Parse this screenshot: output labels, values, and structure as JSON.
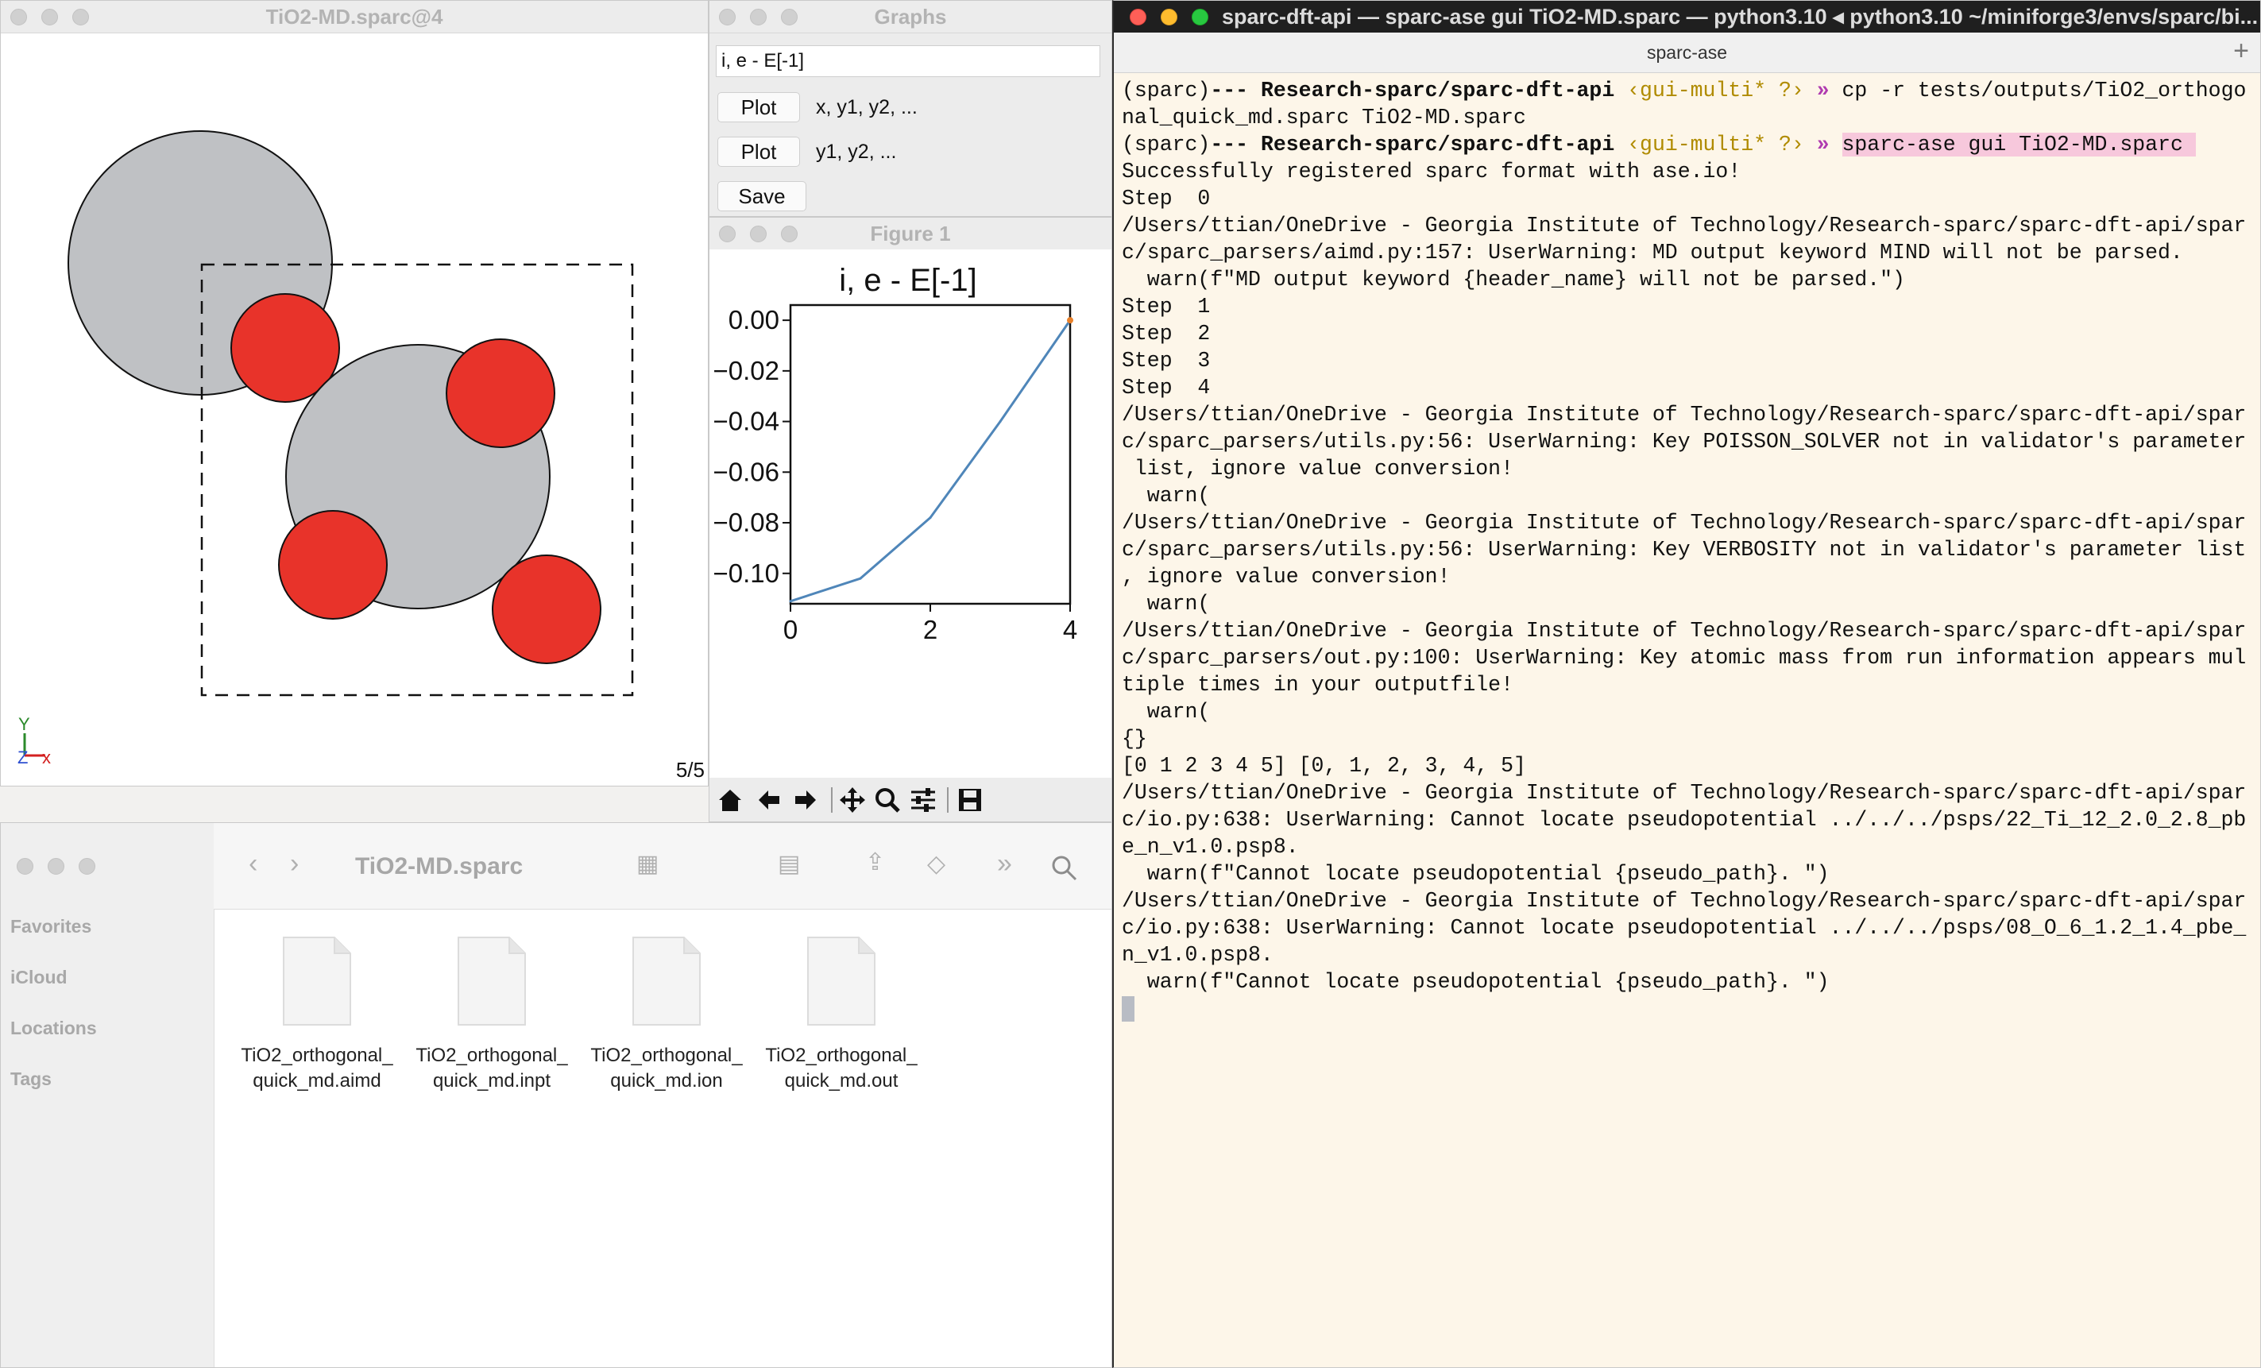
{
  "ase_viewer": {
    "title": "TiO2-MD.sparc@4",
    "frame_counter": "5/5",
    "axis_labels": {
      "y": "Y",
      "z": "Z",
      "x": "x"
    },
    "atom_colors": {
      "titanium": "#bfc1c4",
      "oxygen": "#e8332a"
    }
  },
  "graphs": {
    "title": "Graphs",
    "expression": "i, e - E[-1]",
    "buttons": [
      {
        "label": "Plot",
        "description": "x, y1, y2, ..."
      },
      {
        "label": "Plot",
        "description": "y1, y2, ..."
      }
    ],
    "save_label": "Save"
  },
  "figure": {
    "title": "Figure 1",
    "toolbar_icons": [
      "home-icon",
      "back-arrow-icon",
      "forward-arrow-icon",
      "pan-icon",
      "zoom-icon",
      "configure-icon",
      "save-icon"
    ]
  },
  "chart_data": {
    "type": "line",
    "title": "i, e - E[-1]",
    "x": [
      0,
      1,
      2,
      3,
      4
    ],
    "series": [
      {
        "values": [
          -0.111,
          -0.102,
          -0.078,
          -0.04,
          0.0
        ]
      }
    ],
    "xlim": [
      0,
      4
    ],
    "ylim": [
      -0.112,
      0.006
    ],
    "xticks": [
      "0",
      "2",
      "4"
    ],
    "yticks": [
      "0.00",
      "−0.02",
      "−0.04",
      "−0.06",
      "−0.08",
      "−0.10"
    ],
    "line_color": "#4f86b9"
  },
  "finder": {
    "title": "TiO2-MD.sparc",
    "sidebar": [
      "Favorites",
      "iCloud",
      "Locations",
      "Tags"
    ],
    "files": [
      {
        "line1": "TiO2_orthogonal_",
        "line2": "quick_md.aimd"
      },
      {
        "line1": "TiO2_orthogonal_",
        "line2": "quick_md.inpt"
      },
      {
        "line1": "TiO2_orthogonal_",
        "line2": "quick_md.ion"
      },
      {
        "line1": "TiO2_orthogonal_",
        "line2": "quick_md.out"
      }
    ]
  },
  "terminal": {
    "title": "sparc-dft-api — sparc-ase gui TiO2-MD.sparc — python3.10 ◂ python3.10 ~/miniforge3/envs/sparc/bi...",
    "tab": "sparc-ase",
    "prompt_env": "(sparc)",
    "prompt_sep": "---",
    "prompt_path": "Research-sparc/sparc-dft-api",
    "prompt_branch": "‹gui-multi* ?›",
    "prompt_arrow": "»",
    "cmd1": "cp -r tests/outputs/TiO2_orthogo",
    "cmd1_cont": "nal_quick_md.sparc TiO2-MD.sparc",
    "cmd2": "sparc-ase gui TiO2-MD.sparc ",
    "output_lines": [
      "Successfully registered sparc format with ase.io!",
      "Step  0",
      "/Users/ttian/OneDrive - Georgia Institute of Technology/Research-sparc/sparc-dft-api/spar",
      "c/sparc_parsers/aimd.py:157: UserWarning: MD output keyword MIND will not be parsed.",
      "  warn(f\"MD output keyword {header_name} will not be parsed.\")",
      "Step  1",
      "Step  2",
      "Step  3",
      "Step  4",
      "/Users/ttian/OneDrive - Georgia Institute of Technology/Research-sparc/sparc-dft-api/spar",
      "c/sparc_parsers/utils.py:56: UserWarning: Key POISSON_SOLVER not in validator's parameter",
      " list, ignore value conversion!",
      "  warn(",
      "/Users/ttian/OneDrive - Georgia Institute of Technology/Research-sparc/sparc-dft-api/spar",
      "c/sparc_parsers/utils.py:56: UserWarning: Key VERBOSITY not in validator's parameter list",
      ", ignore value conversion!",
      "  warn(",
      "/Users/ttian/OneDrive - Georgia Institute of Technology/Research-sparc/sparc-dft-api/spar",
      "c/sparc_parsers/out.py:100: UserWarning: Key atomic mass from run information appears mul",
      "tiple times in your outputfile!",
      "  warn(",
      "{}",
      "[0 1 2 3 4 5] [0, 1, 2, 3, 4, 5]",
      "/Users/ttian/OneDrive - Georgia Institute of Technology/Research-sparc/sparc-dft-api/spar",
      "c/io.py:638: UserWarning: Cannot locate pseudopotential ../../../psps/22_Ti_12_2.0_2.8_pb",
      "e_n_v1.0.psp8.",
      "  warn(f\"Cannot locate pseudopotential {pseudo_path}. \")",
      "/Users/ttian/OneDrive - Georgia Institute of Technology/Research-sparc/sparc-dft-api/spar",
      "c/io.py:638: UserWarning: Cannot locate pseudopotential ../../../psps/08_O_6_1.2_1.4_pbe_",
      "n_v1.0.psp8.",
      "  warn(f\"Cannot locate pseudopotential {pseudo_path}. \")"
    ]
  }
}
